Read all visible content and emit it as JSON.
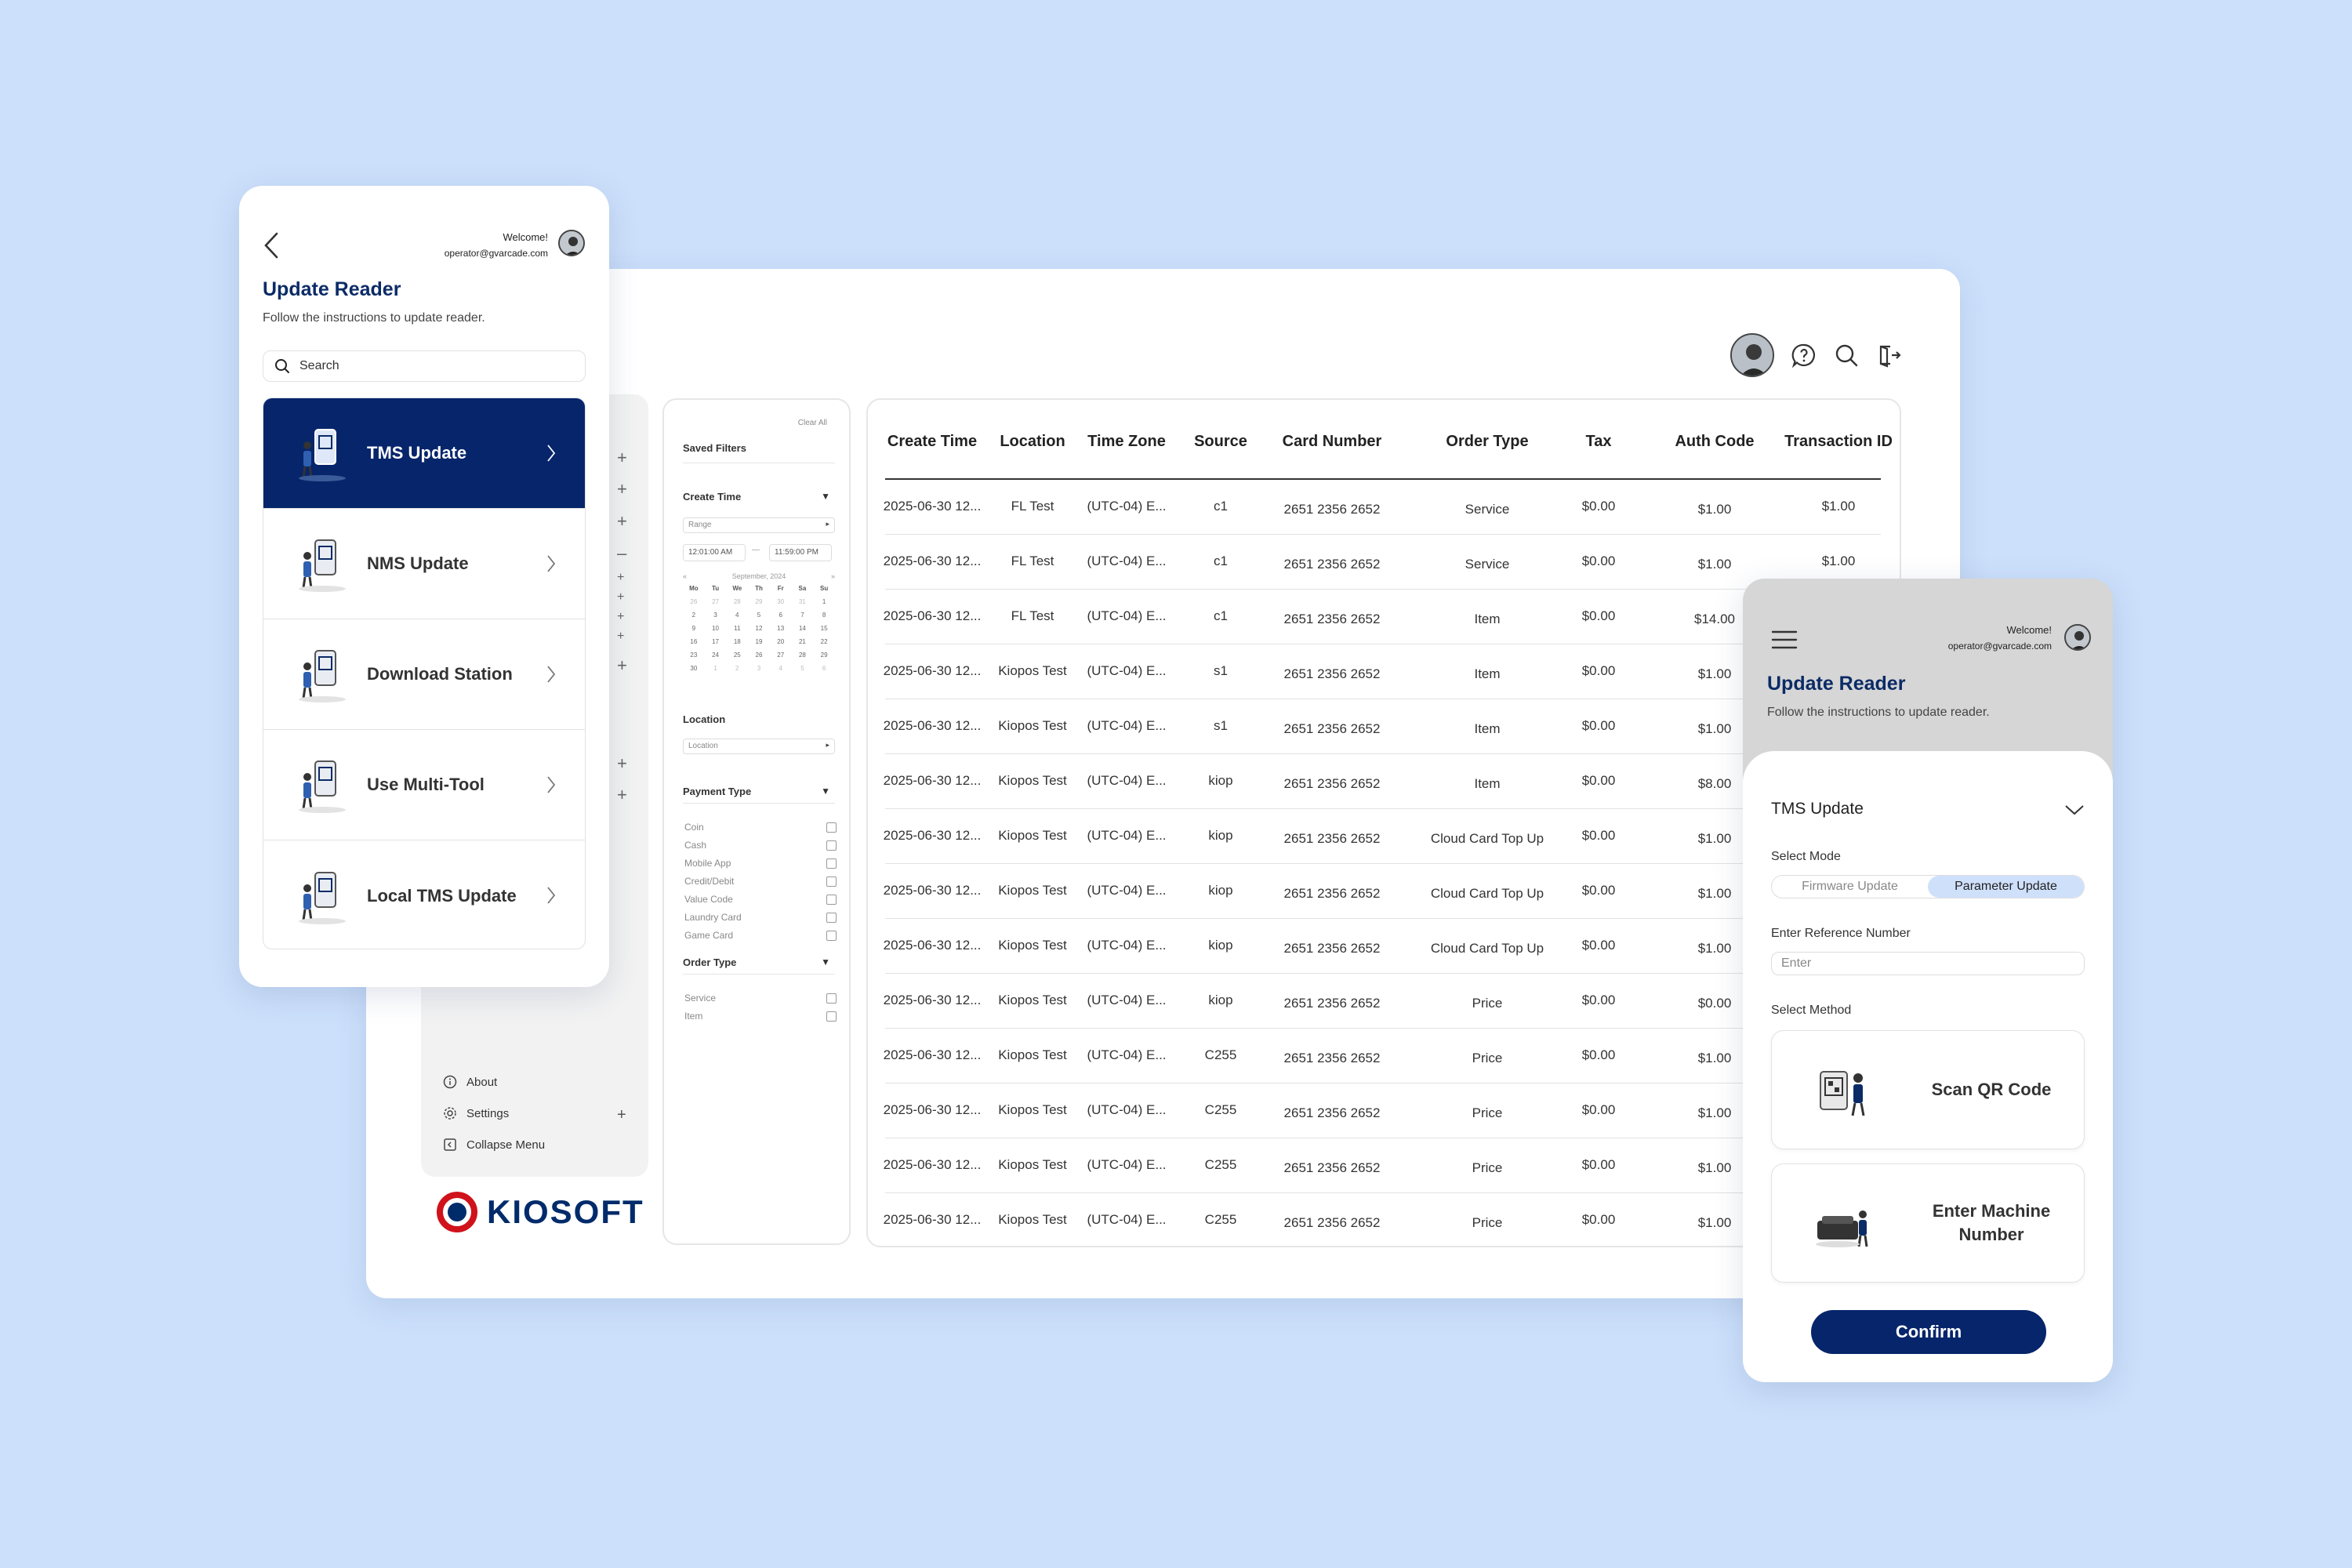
{
  "desktop": {
    "sidebar": {
      "about": "About",
      "settings": "Settings",
      "collapse": "Collapse Menu"
    },
    "logo": "KIOSOFT",
    "filters": {
      "clear_all": "Clear All",
      "saved_filters": "Saved Filters",
      "create_time": "Create Time",
      "range_placeholder": "Range",
      "time_from": "12:01:00 AM",
      "time_to": "11:59:00 PM",
      "calendar_month": "September, 2024",
      "weekdays": [
        "Mo",
        "Tu",
        "We",
        "Th",
        "Fr",
        "Sa",
        "Su"
      ],
      "location": "Location",
      "location_placeholder": "Location",
      "payment_type": "Payment Type",
      "payment_options": [
        "Coin",
        "Cash",
        "Mobile App",
        "Credit/Debit",
        "Value Code",
        "Laundry Card",
        "Game Card"
      ],
      "order_type": "Order Type",
      "order_options": [
        "Service",
        "Item"
      ]
    },
    "table": {
      "headers": [
        "Create Time",
        "Location",
        "Time Zone",
        "Source",
        "Card Number",
        "Order Type",
        "Tax",
        "Auth Code",
        "Transaction ID"
      ],
      "rows": [
        [
          "2025-06-30 12...",
          "FL Test",
          "(UTC-04) E...",
          "c1",
          "2651 2356 2652",
          "Service",
          "$0.00",
          "$1.00",
          "$1.00"
        ],
        [
          "2025-06-30 12...",
          "FL Test",
          "(UTC-04) E...",
          "c1",
          "2651 2356 2652",
          "Service",
          "$0.00",
          "$1.00",
          "$1.00"
        ],
        [
          "2025-06-30 12...",
          "FL Test",
          "(UTC-04) E...",
          "c1",
          "2651 2356 2652",
          "Item",
          "$0.00",
          "$14.00",
          ""
        ],
        [
          "2025-06-30 12...",
          "Kiopos Test",
          "(UTC-04) E...",
          "s1",
          "2651 2356 2652",
          "Item",
          "$0.00",
          "$1.00",
          ""
        ],
        [
          "2025-06-30 12...",
          "Kiopos Test",
          "(UTC-04) E...",
          "s1",
          "2651 2356 2652",
          "Item",
          "$0.00",
          "$1.00",
          ""
        ],
        [
          "2025-06-30 12...",
          "Kiopos Test",
          "(UTC-04) E...",
          "kiop",
          "2651 2356 2652",
          "Item",
          "$0.00",
          "$8.00",
          ""
        ],
        [
          "2025-06-30 12...",
          "Kiopos Test",
          "(UTC-04) E...",
          "kiop",
          "2651 2356 2652",
          "Cloud Card Top Up",
          "$0.00",
          "$1.00",
          ""
        ],
        [
          "2025-06-30 12...",
          "Kiopos Test",
          "(UTC-04) E...",
          "kiop",
          "2651 2356 2652",
          "Cloud Card Top Up",
          "$0.00",
          "$1.00",
          ""
        ],
        [
          "2025-06-30 12...",
          "Kiopos Test",
          "(UTC-04) E...",
          "kiop",
          "2651 2356 2652",
          "Cloud Card Top Up",
          "$0.00",
          "$1.00",
          ""
        ],
        [
          "2025-06-30 12...",
          "Kiopos Test",
          "(UTC-04) E...",
          "kiop",
          "2651 2356 2652",
          "Price",
          "$0.00",
          "$0.00",
          ""
        ],
        [
          "2025-06-30 12...",
          "Kiopos Test",
          "(UTC-04) E...",
          "C255",
          "2651 2356 2652",
          "Price",
          "$0.00",
          "$1.00",
          ""
        ],
        [
          "2025-06-30 12...",
          "Kiopos Test",
          "(UTC-04) E...",
          "C255",
          "2651 2356 2652",
          "Price",
          "$0.00",
          "$1.00",
          ""
        ],
        [
          "2025-06-30 12...",
          "Kiopos Test",
          "(UTC-04) E...",
          "C255",
          "2651 2356 2652",
          "Price",
          "$0.00",
          "$1.00",
          ""
        ],
        [
          "2025-06-30 12...",
          "Kiopos Test",
          "(UTC-04) E...",
          "C255",
          "2651 2356 2652",
          "Price",
          "$0.00",
          "$1.00",
          ""
        ]
      ]
    }
  },
  "phone_left": {
    "welcome": "Welcome!",
    "email": "operator@gvarcade.com",
    "title": "Update Reader",
    "subtitle": "Follow the instructions to update reader.",
    "search_placeholder": "Search",
    "menu": [
      {
        "label": "TMS Update",
        "icon": "tms-illustration",
        "active": true
      },
      {
        "label": "NMS Update",
        "icon": "nms-illustration",
        "active": false
      },
      {
        "label": "Download Station",
        "icon": "download-illustration",
        "active": false
      },
      {
        "label": "Use Multi-Tool",
        "icon": "multitool-illustration",
        "active": false
      },
      {
        "label": "Local TMS Update",
        "icon": "local-tms-illustration",
        "active": false
      }
    ]
  },
  "phone_right": {
    "welcome": "Welcome!",
    "email": "operator@gvarcade.com",
    "title": "Update Reader",
    "subtitle": "Follow the instructions to update reader.",
    "selected_update": "TMS Update",
    "select_mode_label": "Select Mode",
    "modes": [
      "Firmware Update",
      "Parameter Update"
    ],
    "active_mode": "Parameter Update",
    "ref_label": "Enter Reference Number",
    "ref_placeholder": "Enter",
    "method_label": "Select Method",
    "methods": [
      "Scan QR Code",
      "Enter Machine Number"
    ],
    "confirm": "Confirm"
  },
  "colors": {
    "background": "#cce0fb",
    "primary": "#06256b",
    "title": "#0b2b66",
    "segment_active": "#cfe0fb"
  }
}
